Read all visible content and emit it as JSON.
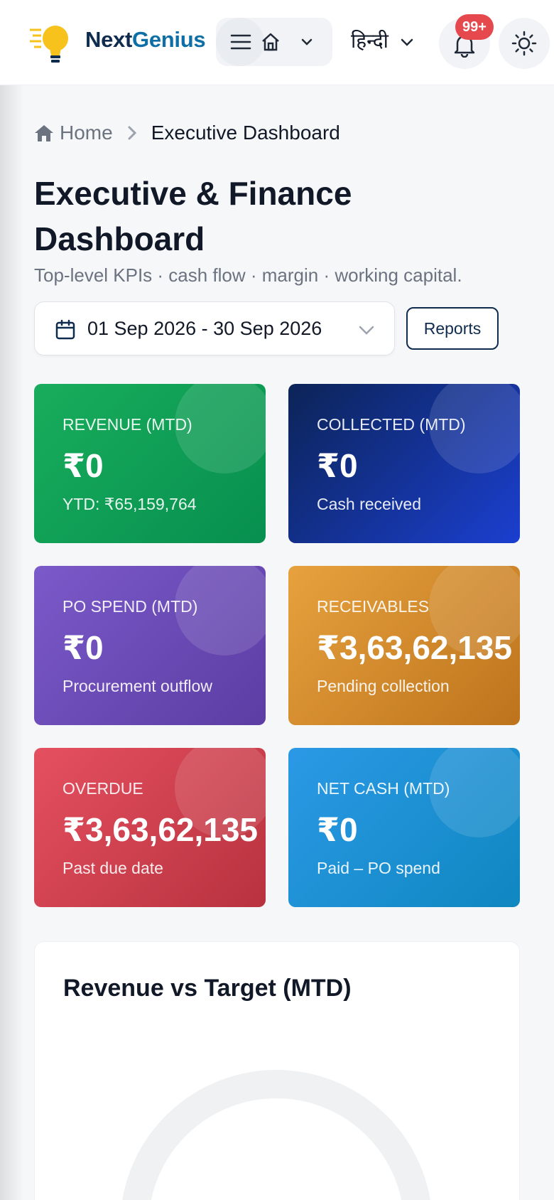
{
  "header": {
    "brand_part1": "Next",
    "brand_part2": "Genius",
    "language": "हिन्दी",
    "notification_count": "99+"
  },
  "breadcrumb": {
    "home": "Home",
    "current": "Executive Dashboard"
  },
  "page": {
    "title": "Executive & Finance Dashboard",
    "subtitle": "Top-level KPIs · cash flow · margin · working capital."
  },
  "filters": {
    "date_range": "01 Sep 2026 - 30 Sep 2026",
    "reports_label": "Reports"
  },
  "kpis": [
    {
      "label": "REVENUE (MTD)",
      "value": "₹0",
      "sub": "YTD: ₹65,159,764",
      "color": "#10a257"
    },
    {
      "label": "COLLECTED (MTD)",
      "value": "₹0",
      "sub": "Cash received",
      "color": "#12309a"
    },
    {
      "label": "PO SPEND (MTD)",
      "value": "₹0",
      "sub": "Procurement outflow",
      "color": "#6a4bb6"
    },
    {
      "label": "RECEIVABLES",
      "value": "₹3,63,62,135",
      "sub": "Pending collection",
      "color": "#d38b2c"
    },
    {
      "label": "OVERDUE",
      "value": "₹3,63,62,135",
      "sub": "Past due date",
      "color": "#cf404e"
    },
    {
      "label": "NET CASH (MTD)",
      "value": "₹0",
      "sub": "Paid – PO spend",
      "color": "#1d90d3"
    }
  ],
  "chart_data": {
    "type": "gauge",
    "title": "Revenue vs Target (MTD)"
  },
  "colors": {
    "brand_dark": "#0f2c4f",
    "brand_accent": "#0e6fa6",
    "badge": "#e5484d"
  }
}
